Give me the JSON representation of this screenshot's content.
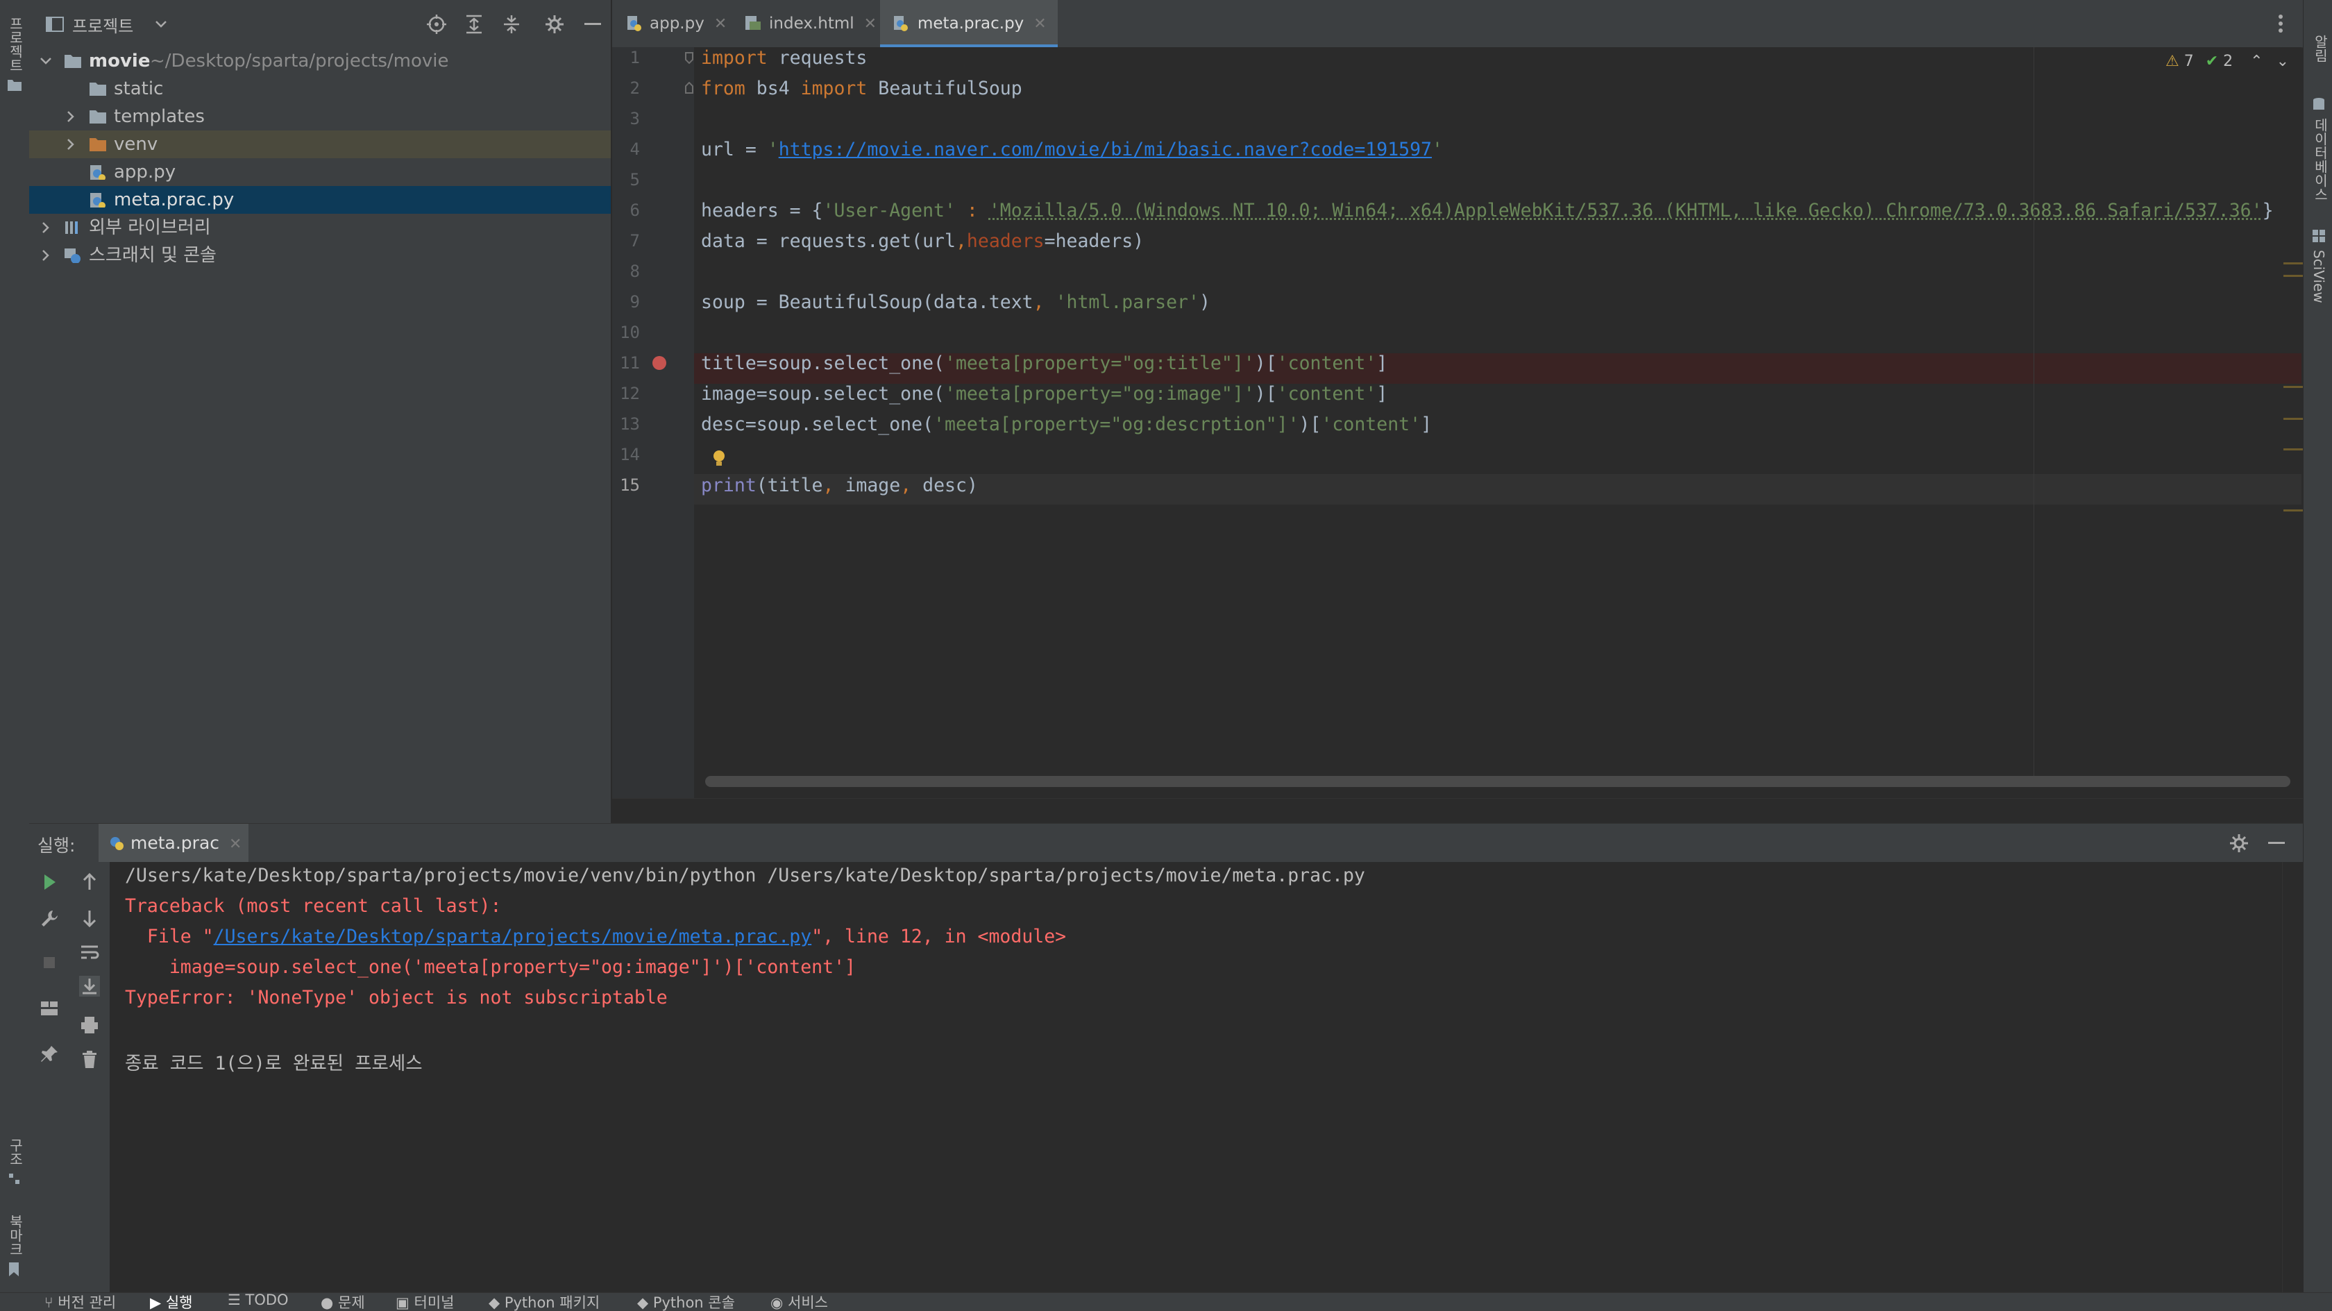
{
  "left_strip": {
    "project_label": "프로젝트",
    "structure_label": "구조",
    "bookmarks_label": "북마크"
  },
  "right_strip": {
    "notifications_label": "알림",
    "database_label": "데이터베이스",
    "sciview_label": "SciView"
  },
  "project_panel": {
    "title": "프로젝트",
    "tree": {
      "root_name": "movie",
      "root_path": "~/Desktop/sparta/projects/movie",
      "static": "static",
      "templates": "templates",
      "venv": "venv",
      "app_py": "app.py",
      "meta_prac_py": "meta.prac.py",
      "external_libs": "외부 라이브러리",
      "scratches": "스크래치 및 콘솔"
    }
  },
  "tabs": [
    {
      "label": "app.py",
      "active": false
    },
    {
      "label": "index.html",
      "active": false
    },
    {
      "label": "meta.prac.py",
      "active": true
    }
  ],
  "inspections": {
    "warnings": "7",
    "ok": "2"
  },
  "code": {
    "line_numbers": [
      "1",
      "2",
      "3",
      "4",
      "5",
      "6",
      "7",
      "8",
      "9",
      "10",
      "11",
      "12",
      "13",
      "14",
      "15"
    ],
    "l1_kw": "import",
    "l1_rest": " requests",
    "l2_kw1": "from",
    "l2_mod": " bs4 ",
    "l2_kw2": "import",
    "l2_rest": " BeautifulSoup",
    "l4_pre": "url = ",
    "l4_q1": "'",
    "l4_url": "https://movie.naver.com/movie/bi/mi/basic.naver?code=191597",
    "l4_q2": "'",
    "l6_pre": "headers = {",
    "l6_key": "'User-Agent'",
    "l6_colon": " : ",
    "l6_val": "'Mozilla/5.0 (Windows NT 10.0; Win64; x64)AppleWebKit/537.36 (KHTML, like Gecko) Chrome/73.0.3683.86 Safari/537.36'",
    "l6_end": "}",
    "l7_pre": "data = requests.get(url",
    "l7_comma": ",",
    "l7_param": "headers",
    "l7_rest": "=headers)",
    "l9_pre": "soup = BeautifulSoup(data.text",
    "l9_comma": ", ",
    "l9_str": "'html.parser'",
    "l9_end": ")",
    "l11_pre": "title=soup.select_one(",
    "l11_str": "'meeta[property=\"og:title\"]'",
    "l11_mid": ")[",
    "l11_str2": "'content'",
    "l11_end": "]",
    "l12_pre": "image=soup.select_one(",
    "l12_str": "'meeta[property=\"og:image\"]'",
    "l12_mid": ")[",
    "l12_str2": "'content'",
    "l12_end": "]",
    "l13_pre": "desc=soup.select_one(",
    "l13_str": "'meeta[property=\"og:descrption\"]'",
    "l13_mid": ")[",
    "l13_str2": "'content'",
    "l13_end": "]",
    "l15_fn": "print",
    "l15_args1": "(title",
    "l15_c1": ", ",
    "l15_args2": "image",
    "l15_c2": ", ",
    "l15_args3": "desc)"
  },
  "run_panel": {
    "label": "실행:",
    "tab": "meta.prac",
    "console": {
      "cmd": "/Users/kate/Desktop/sparta/projects/movie/venv/bin/python /Users/kate/Desktop/sparta/projects/movie/meta.prac.py",
      "tb1": "Traceback (most recent call last):",
      "tb2_pre": "  File \"",
      "tb2_link": "/Users/kate/Desktop/sparta/projects/movie/meta.prac.py",
      "tb2_post": "\", line 12, in <module>",
      "tb3": "    image=soup.select_one('meeta[property=\"og:image\"]')['content']",
      "tb4": "TypeError: 'NoneType' object is not subscriptable",
      "exit": "종료 코드 1(으)로 완료된 프로세스"
    }
  },
  "bottom_bar": {
    "vcs": "버전 관리",
    "run": "실행",
    "todo": "TODO",
    "problems": "문제",
    "terminal": "터미널",
    "python_packages": "Python 패키지",
    "python_console": "Python 콘솔",
    "services": "서비스"
  },
  "colors": {
    "keyword": "#cc7832",
    "string": "#6a8759",
    "error_text": "#ff6b68",
    "link": "#287bde",
    "background": "#2b2b2b",
    "panel": "#3c3f41"
  }
}
